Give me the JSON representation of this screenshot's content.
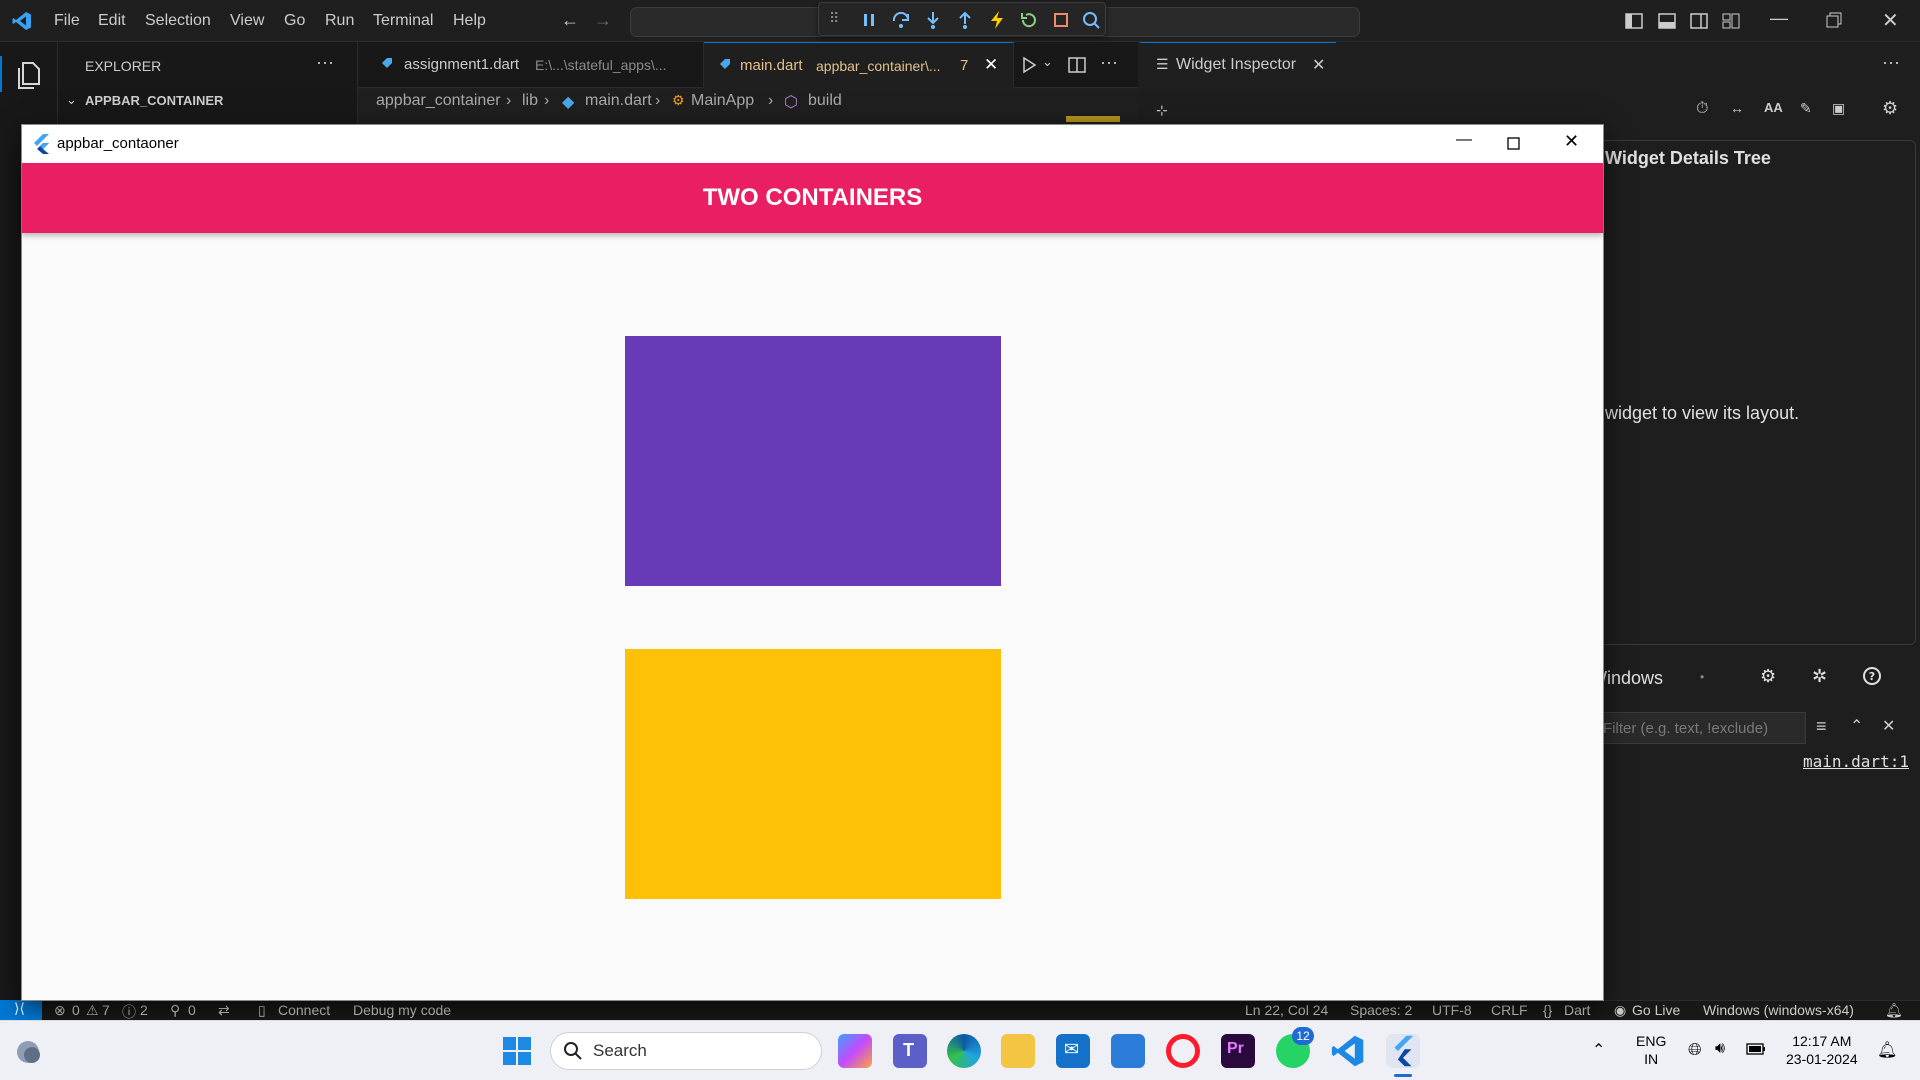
{
  "menu": [
    "File",
    "Edit",
    "Selection",
    "View",
    "Go",
    "Run",
    "Terminal",
    "Help"
  ],
  "explorer": {
    "title": "EXPLORER",
    "section": "APPBAR_CONTAINER"
  },
  "tabs": [
    {
      "label": "assignment1.dart",
      "path": "E:\\...\\stateful_apps\\..."
    },
    {
      "label": "main.dart",
      "path": "appbar_container\\...",
      "badge": "7"
    }
  ],
  "inspector_tab": "Widget Inspector",
  "breadcrumbs": [
    "appbar_container",
    "lib",
    "main.dart",
    "MainApp",
    "build"
  ],
  "inspector": {
    "details_title": "Widget Details Tree",
    "details_hint": "widget to view its layout.",
    "debug_title": "Windows",
    "filter_placeholder": "Filter (e.g. text, !exclude)",
    "log_link": "main.dart:1"
  },
  "app": {
    "window_title": "appbar_contaoner",
    "appbar_title": "TWO CONTAINERS",
    "appbar_color": "#e91e63",
    "container_colors": [
      "#673ab7",
      "#ffc107"
    ]
  },
  "status": {
    "problems": "0",
    "warnings": "7",
    "infos": "2",
    "ports": "0",
    "connect": "Connect",
    "debug": "Debug my code",
    "position": "Ln 22, Col 24",
    "spaces": "Spaces: 2",
    "encoding": "UTF-8",
    "eol": "CRLF",
    "language": "Dart",
    "golive": "Go Live",
    "device": "Windows (windows-x64)"
  },
  "taskbar": {
    "search": "Search",
    "whatsapp_badge": "12",
    "lang_1": "ENG",
    "lang_2": "IN",
    "time": "12:17 AM",
    "date": "23-01-2024"
  }
}
